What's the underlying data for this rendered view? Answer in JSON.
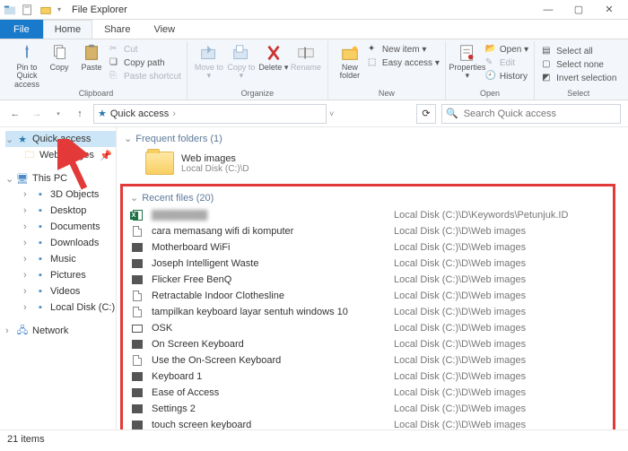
{
  "window": {
    "title": "File Explorer",
    "min_icon": "—",
    "max_icon": "▢",
    "close_icon": "✕"
  },
  "tabs": {
    "file": "File",
    "home": "Home",
    "share": "Share",
    "view": "View"
  },
  "ribbon": {
    "clipboard": {
      "name": "Clipboard",
      "pin": "Pin to Quick access",
      "copy": "Copy",
      "paste": "Paste",
      "cut": "Cut",
      "copypath": "Copy path",
      "pasteshortcut": "Paste shortcut"
    },
    "organize": {
      "name": "Organize",
      "moveto": "Move to ▾",
      "copyto": "Copy to ▾",
      "delete": "Delete ▾",
      "rename": "Rename"
    },
    "new": {
      "name": "New",
      "newfolder": "New folder",
      "newitem": "New item ▾",
      "easyaccess": "Easy access ▾"
    },
    "open": {
      "name": "Open",
      "properties": "Properties ▾",
      "open": "Open ▾",
      "edit": "Edit",
      "history": "History"
    },
    "select": {
      "name": "Select",
      "all": "Select all",
      "none": "Select none",
      "invert": "Invert selection"
    }
  },
  "nav": {
    "back": "←",
    "forward": "→",
    "up": "↑",
    "location": "Quick access",
    "sep": "›",
    "refresh": "⟳",
    "search_placeholder": "Search Quick access",
    "search_icon": "🔍"
  },
  "tree": {
    "quickaccess": "Quick access",
    "webimages": "Web images",
    "thispc": "This PC",
    "thispc_items": [
      "3D Objects",
      "Desktop",
      "Documents",
      "Downloads",
      "Music",
      "Pictures",
      "Videos",
      "Local Disk (C:)"
    ],
    "network": "Network"
  },
  "frequent": {
    "header": "Frequent folders (1)",
    "folder_name": "Web images",
    "folder_path": "Local Disk (C:)\\D"
  },
  "recent": {
    "header": "Recent files (20)",
    "items": [
      {
        "icon": "excel",
        "name": "████████",
        "path": "Local Disk (C:)\\D\\Keywords\\Petunjuk.ID",
        "blur": true
      },
      {
        "icon": "doc",
        "name": "cara memasang wifi di komputer",
        "path": "Local Disk (C:)\\D\\Web images"
      },
      {
        "icon": "img",
        "name": "Motherboard WiFi",
        "path": "Local Disk (C:)\\D\\Web images"
      },
      {
        "icon": "img",
        "name": "Joseph Intelligent Waste",
        "path": "Local Disk (C:)\\D\\Web images"
      },
      {
        "icon": "img",
        "name": "Flicker Free BenQ",
        "path": "Local Disk (C:)\\D\\Web images"
      },
      {
        "icon": "doc",
        "name": "Retractable Indoor Clothesline",
        "path": "Local Disk (C:)\\D\\Web images"
      },
      {
        "icon": "doc",
        "name": "tampilkan keyboard layar sentuh windows 10",
        "path": "Local Disk (C:)\\D\\Web images"
      },
      {
        "icon": "imgb",
        "name": "OSK",
        "path": "Local Disk (C:)\\D\\Web images"
      },
      {
        "icon": "img",
        "name": "On Screen Keyboard",
        "path": "Local Disk (C:)\\D\\Web images"
      },
      {
        "icon": "doc",
        "name": "Use the On-Screen Keyboard",
        "path": "Local Disk (C:)\\D\\Web images"
      },
      {
        "icon": "img",
        "name": "Keyboard 1",
        "path": "Local Disk (C:)\\D\\Web images"
      },
      {
        "icon": "img",
        "name": "Ease of Access",
        "path": "Local Disk (C:)\\D\\Web images"
      },
      {
        "icon": "img",
        "name": "Settings 2",
        "path": "Local Disk (C:)\\D\\Web images"
      },
      {
        "icon": "img",
        "name": "touch screen keyboard",
        "path": "Local Disk (C:)\\D\\Web images"
      }
    ]
  },
  "status": {
    "count": "21 items"
  }
}
